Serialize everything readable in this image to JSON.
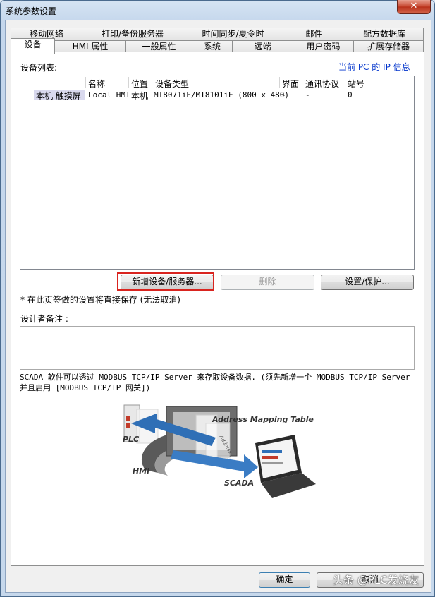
{
  "window": {
    "title": "系统参数设置",
    "close_glyph": "✕"
  },
  "tabs_row1": [
    "移动网络",
    "打印/备份服务器",
    "时间同步/夏令时",
    "邮件",
    "配方数据库"
  ],
  "tabs_row2": [
    "设备",
    "HMI 属性",
    "一般属性",
    "系统",
    "远端",
    "用户密码",
    "扩展存储器"
  ],
  "active_tab": "设备",
  "device_list_label": "设备列表:",
  "pc_ip_link": "当前 PC 的 IP 信息",
  "columns": [
    "名称",
    "位置",
    "设备类型",
    "界面",
    "通讯协议",
    "站号"
  ],
  "rows": [
    {
      "type_label": "本机 触摸屏",
      "name": "Local HMI",
      "location": "本机",
      "device_type": "MT8071iE/MT8101iE (800 x 480)",
      "interface": "-",
      "protocol": "-",
      "station": "0"
    }
  ],
  "buttons": {
    "add": "新增设备/服务器...",
    "delete": "删除",
    "settings": "设置/保护...",
    "ok": "确定",
    "cancel": "取消"
  },
  "note_text": "* 在此页签做的设置将直接保存 (无法取消)",
  "designer_notes_label": "设计者备注 :",
  "designer_notes_value": "",
  "scada_description": "SCADA 软件可以透过 MODBUS TCP/IP Server 来存取设备数据. (须先新增一个 MODBUS TCP/IP Server 并且启用 [MODBUS TCP/IP 网关])",
  "diagram": {
    "title": "Address Mapping Table",
    "plc": "PLC",
    "hmi": "HMI",
    "scada": "SCADA",
    "address": "Address"
  },
  "watermark": "头条 @PLC发烧友",
  "colors": {
    "highlight_border": "#d9241f",
    "link": "#0033cc",
    "close_button": "#c5442c"
  }
}
